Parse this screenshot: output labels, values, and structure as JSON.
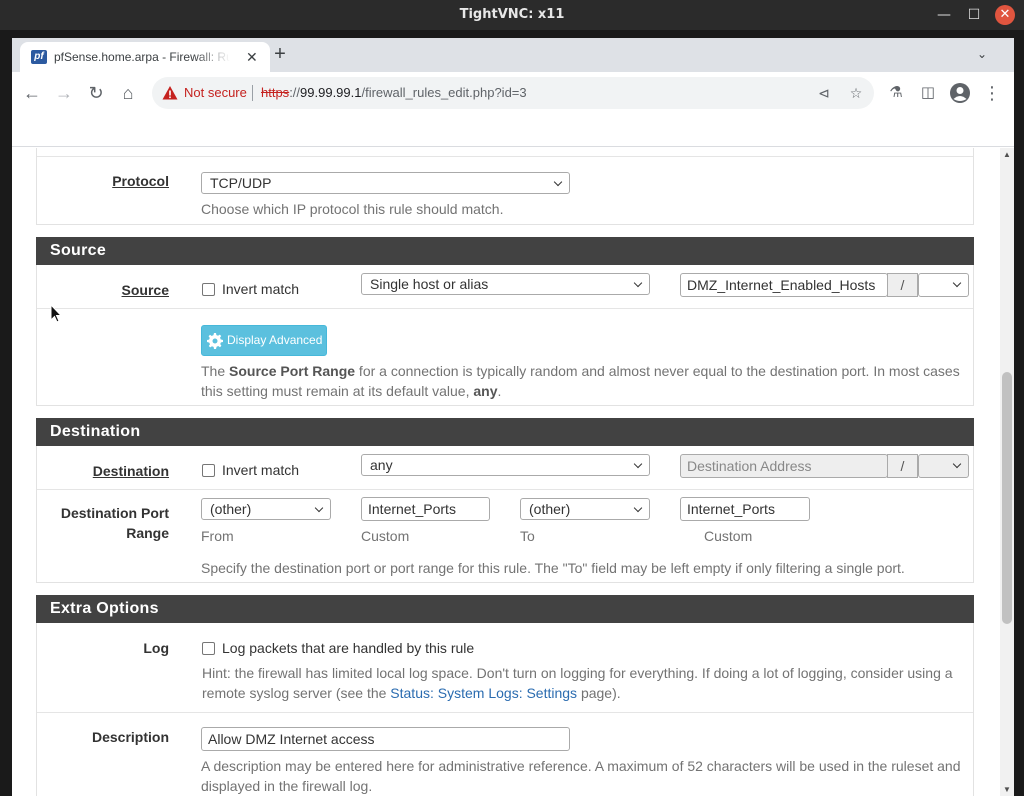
{
  "window": {
    "title": "TightVNC: x11"
  },
  "browser": {
    "tab_title": "pfSense.home.arpa - Firewall: Rules: Edit",
    "favicon_text": "pf",
    "url_scheme": "https",
    "url_sep": "://",
    "url_host": "99.99.99.1",
    "url_path": "/firewall_rules_edit.php?id=3",
    "not_secure": "Not secure"
  },
  "protocol": {
    "label": "Protocol",
    "value": "TCP/UDP",
    "help": "Choose which IP protocol this rule should match."
  },
  "source_section": {
    "heading": "Source",
    "label": "Source",
    "invert_label": "Invert match",
    "type_value": "Single host or alias",
    "address_value": "DMZ_Internet_Enabled_Hosts",
    "slash": "/",
    "advanced_button": "Display Advanced",
    "help_pre": "The ",
    "help_bold": "Source Port Range",
    "help_mid": " for a connection is typically random and almost never equal to the destination port. In most cases this setting must remain at its default value, ",
    "help_any": "any",
    "help_end": "."
  },
  "destination_section": {
    "heading": "Destination",
    "label": "Destination",
    "invert_label": "Invert match",
    "type_value": "any",
    "address_placeholder": "Destination Address",
    "slash": "/",
    "port_label_1": "Destination Port",
    "port_label_2": "Range",
    "from_value": "(other)",
    "from_sub": "From",
    "from_custom": "Internet_Ports",
    "custom_sub_1": "Custom",
    "to_value": "(other)",
    "to_sub": "To",
    "to_custom": "Internet_Ports",
    "custom_sub_2": "Custom",
    "help": "Specify the destination port or port range for this rule. The \"To\" field may be left empty if only filtering a single port."
  },
  "extra_section": {
    "heading": "Extra Options",
    "log_label": "Log",
    "log_checkbox_label": "Log packets that are handled by this rule",
    "log_help_1": "Hint: the firewall has limited local log space. Don't turn on logging for everything. If doing a lot of logging, consider using a",
    "log_help_2_pre": "remote syslog server (see the ",
    "log_help_link": "Status: System Logs: Settings",
    "log_help_2_post": " page).",
    "description_label": "Description",
    "description_value": "Allow DMZ Internet access",
    "description_help_1": "A description may be entered here for administrative reference. A maximum of 52 characters will be used in the ruleset and",
    "description_help_2": "displayed in the firewall log."
  },
  "colors": {
    "heading_bg": "#424242",
    "info_button": "#5bc0de",
    "link": "#2b6cb0",
    "not_secure": "#c5221f"
  }
}
